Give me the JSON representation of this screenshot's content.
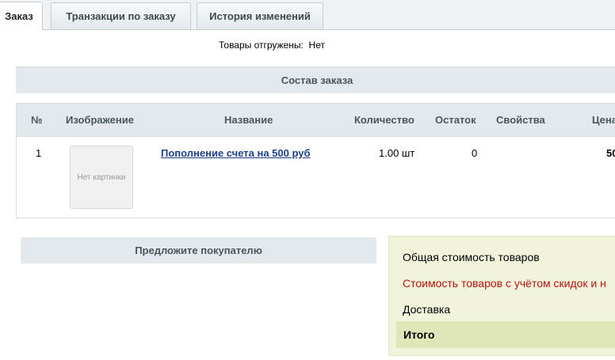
{
  "tabs": [
    {
      "label": "Заказ",
      "active": true
    },
    {
      "label": "Транзакции по заказу",
      "active": false
    },
    {
      "label": "История изменений",
      "active": false
    }
  ],
  "shipped": {
    "label": "Товары отгружены:",
    "value": "Нет"
  },
  "composition": {
    "title": "Состав заказа"
  },
  "table": {
    "headers": [
      "№",
      "Изображение",
      "Название",
      "Количество",
      "Остаток",
      "Свойства",
      "Цена"
    ],
    "rows": [
      {
        "num": "1",
        "image_placeholder": "Нет картинки",
        "name": "Пополнение счета на 500 руб",
        "quantity": "1.00 шт",
        "stock": "0",
        "properties": "",
        "price": "50"
      }
    ]
  },
  "suggest": {
    "title": "Предложите покупателю"
  },
  "totals": {
    "items_cost": "Общая стоимость товаров",
    "discount_cost": "Стоимость товаров с учётом скидок и н",
    "delivery": "Доставка",
    "total": "Итого"
  },
  "colors": {
    "discount_text": "#b5120f",
    "link": "#1d3f8a",
    "totals_bg": "#f1f4db"
  }
}
